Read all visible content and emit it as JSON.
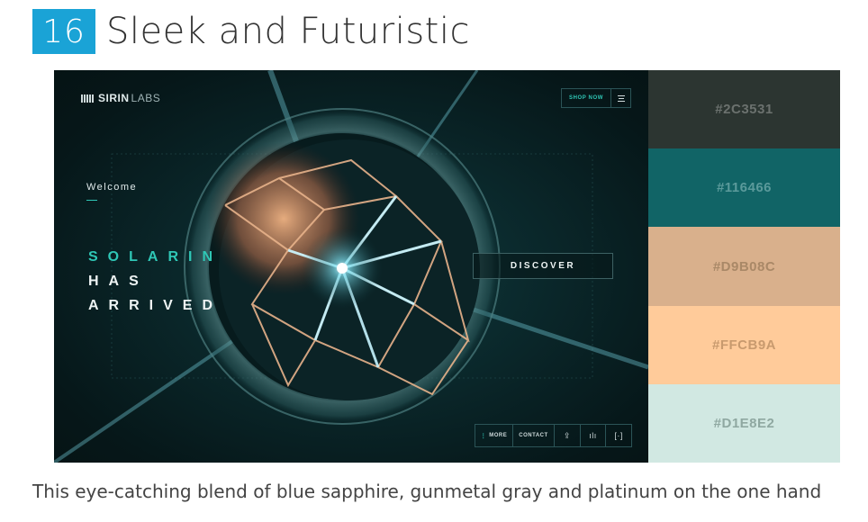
{
  "heading": {
    "number": "16",
    "title": "Sleek and Futuristic"
  },
  "hero": {
    "brand_name": "SIRIN",
    "brand_sub": "LABS",
    "shop_now": "SHOP NOW",
    "welcome": "Welcome",
    "headline": [
      "SOLARIN",
      "HAS",
      "ARRIVED"
    ],
    "discover": "DISCOVER",
    "bottom_bar": {
      "more": "MORE",
      "contact": "CONTACT"
    },
    "accent": "#2fc7b6"
  },
  "palette": [
    {
      "hex": "#2C3531",
      "bg": "#2C3531",
      "text_color": "#6b716e"
    },
    {
      "hex": "#116466",
      "bg": "#116466",
      "text_color": "#5b9a9b"
    },
    {
      "hex": "#D9B08C",
      "bg": "#D9B08C",
      "text_color": "#a98867"
    },
    {
      "hex": "#FFCB9A",
      "bg": "#FFCB9A",
      "text_color": "#c89a6e"
    },
    {
      "hex": "#D1E8E2",
      "bg": "#D1E8E2",
      "text_color": "#8fa8a1"
    }
  ],
  "description": "This eye-catching blend of blue sapphire, gunmetal gray and platinum on the one hand"
}
